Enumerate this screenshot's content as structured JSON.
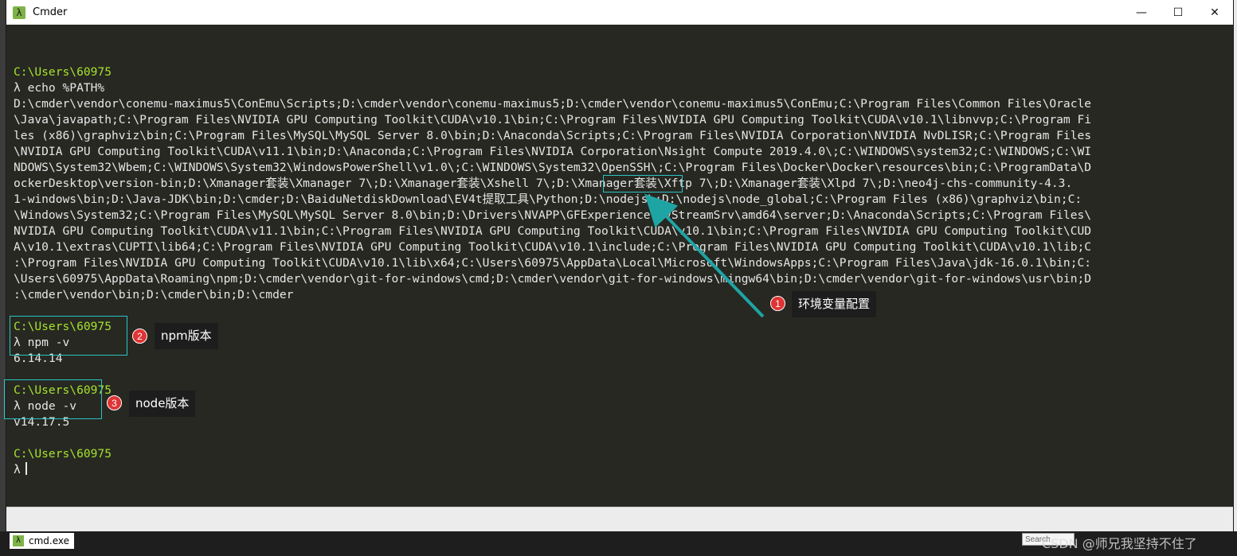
{
  "window": {
    "title": "Cmder",
    "app_icon": "λ",
    "controls": {
      "minimize": "—",
      "maximize": "☐",
      "close": "✕"
    }
  },
  "terminal": {
    "prompt_symbol": "λ",
    "lines": [
      {
        "type": "blank",
        "text": ""
      },
      {
        "type": "path",
        "text": "C:\\Users\\60975"
      },
      {
        "type": "cmd",
        "text": "λ echo %PATH%"
      },
      {
        "type": "out",
        "text": "D:\\cmder\\vendor\\conemu-maximus5\\ConEmu\\Scripts;D:\\cmder\\vendor\\conemu-maximus5;D:\\cmder\\vendor\\conemu-maximus5\\ConEmu;C:\\Program Files\\Common Files\\Oracle"
      },
      {
        "type": "out",
        "text": "\\Java\\javapath;C:\\Program Files\\NVIDIA GPU Computing Toolkit\\CUDA\\v10.1\\bin;C:\\Program Files\\NVIDIA GPU Computing Toolkit\\CUDA\\v10.1\\libnvvp;C:\\Program Fi"
      },
      {
        "type": "out",
        "text": "les (x86)\\graphviz\\bin;C:\\Program Files\\MySQL\\MySQL Server 8.0\\bin;D:\\Anaconda\\Scripts;C:\\Program Files\\NVIDIA Corporation\\NVIDIA NvDLISR;C:\\Program Files"
      },
      {
        "type": "out",
        "text": "\\NVIDIA GPU Computing Toolkit\\CUDA\\v11.1\\bin;D:\\Anaconda;C:\\Program Files\\NVIDIA Corporation\\Nsight Compute 2019.4.0\\;C:\\WINDOWS\\system32;C:\\WINDOWS;C:\\WI"
      },
      {
        "type": "out",
        "text": "NDOWS\\System32\\Wbem;C:\\WINDOWS\\System32\\WindowsPowerShell\\v1.0\\;C:\\WINDOWS\\System32\\OpenSSH\\;C:\\Program Files\\Docker\\Docker\\resources\\bin;C:\\ProgramData\\D"
      },
      {
        "type": "out",
        "text": "ockerDesktop\\version-bin;D:\\Xmanager套装\\Xmanager 7\\;D:\\Xmanager套装\\Xshell 7\\;D:\\Xmanager套装\\Xftp 7\\;D:\\Xmanager套装\\Xlpd 7\\;D:\\neo4j-chs-community-4.3."
      },
      {
        "type": "out",
        "text": "1-windows\\bin;D:\\Java-JDK\\bin;D:\\cmder;D:\\BaiduNetdiskDownload\\EV4t提取工具\\Python;D:\\nodejs\\;D:\\nodejs\\node_global;C:\\Program Files (x86)\\graphviz\\bin;C:"
      },
      {
        "type": "out",
        "text": "\\Windows\\System32;C:\\Program Files\\MySQL\\MySQL Server 8.0\\bin;D:\\Drivers\\NVAPP\\GFExperience.NvStreamSrv\\amd64\\server;D:\\Anaconda\\Scripts;C:\\Program Files\\"
      },
      {
        "type": "out",
        "text": "NVIDIA GPU Computing Toolkit\\CUDA\\v11.1\\bin;C:\\Program Files\\NVIDIA GPU Computing Toolkit\\CUDA\\v10.1\\bin;C:\\Program Files\\NVIDIA GPU Computing Toolkit\\CUD"
      },
      {
        "type": "out",
        "text": "A\\v10.1\\extras\\CUPTI\\lib64;C:\\Program Files\\NVIDIA GPU Computing Toolkit\\CUDA\\v10.1\\include;C:\\Program Files\\NVIDIA GPU Computing Toolkit\\CUDA\\v10.1\\lib;C"
      },
      {
        "type": "out",
        "text": ":\\Program Files\\NVIDIA GPU Computing Toolkit\\CUDA\\v10.1\\lib\\x64;C:\\Users\\60975\\AppData\\Local\\Microsoft\\WindowsApps;C:\\Program Files\\Java\\jdk-16.0.1\\bin;C:"
      },
      {
        "type": "out",
        "text": "\\Users\\60975\\AppData\\Roaming\\npm;D:\\cmder\\vendor\\git-for-windows\\cmd;D:\\cmder\\vendor\\git-for-windows\\mingw64\\bin;D:\\cmder\\vendor\\git-for-windows\\usr\\bin;D"
      },
      {
        "type": "out",
        "text": ":\\cmder\\vendor\\bin;D:\\cmder\\bin;D:\\cmder"
      },
      {
        "type": "blank",
        "text": ""
      },
      {
        "type": "path",
        "text": "C:\\Users\\60975"
      },
      {
        "type": "cmd",
        "text": "λ npm -v"
      },
      {
        "type": "out",
        "text": "6.14.14"
      },
      {
        "type": "blank",
        "text": ""
      },
      {
        "type": "path",
        "text": "C:\\Users\\60975"
      },
      {
        "type": "cmd",
        "text": "λ node -v"
      },
      {
        "type": "out",
        "text": "v14.17.5"
      },
      {
        "type": "blank",
        "text": ""
      },
      {
        "type": "path",
        "text": "C:\\Users\\60975"
      },
      {
        "type": "prompt",
        "text": "λ"
      }
    ]
  },
  "annotations": [
    {
      "number": "1",
      "label": "环境变量配置"
    },
    {
      "number": "2",
      "label": "npm版本"
    },
    {
      "number": "3",
      "label": "node版本"
    }
  ],
  "colors": {
    "terminal_bg": "#272822",
    "prompt_path": "#a6e22e",
    "text": "#e6e6e6",
    "highlight": "#2bc3c3",
    "badge": "#e03434"
  },
  "taskbar": {
    "item_label": "cmd.exe",
    "watermark": "CSDN @师兄我坚持不住了",
    "search_placeholder": "Search"
  }
}
